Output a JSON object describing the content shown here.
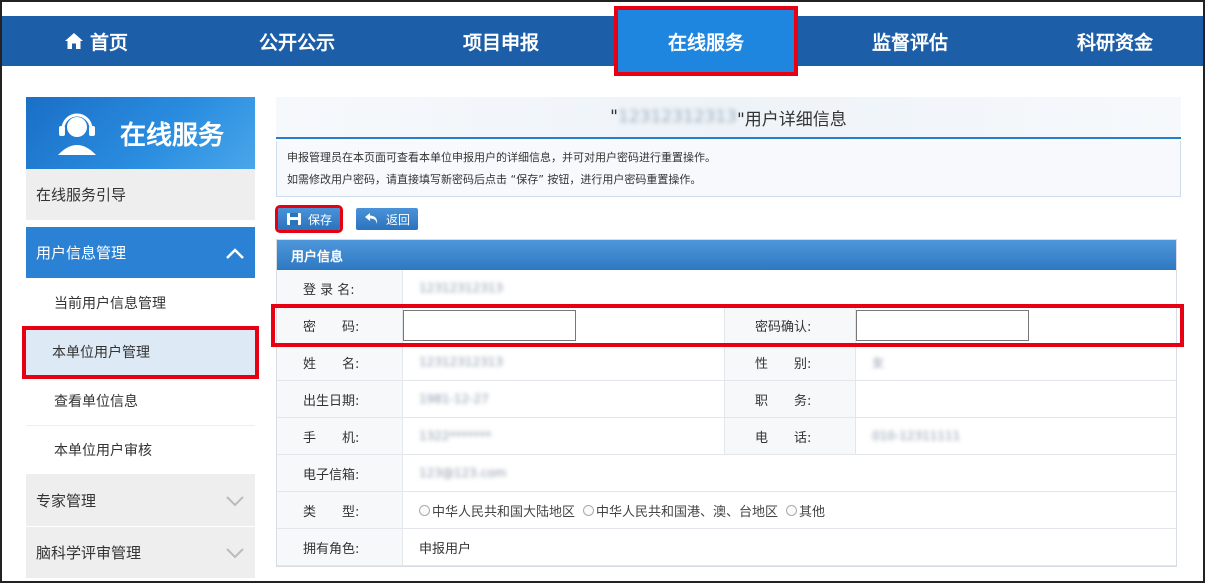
{
  "nav": {
    "items": [
      {
        "label": "首页",
        "icon": "home-icon"
      },
      {
        "label": "公开公示"
      },
      {
        "label": "项目申报"
      },
      {
        "label": "在线服务",
        "active": true
      },
      {
        "label": "监督评估"
      },
      {
        "label": "科研资金"
      }
    ]
  },
  "sidebar": {
    "title": "在线服务",
    "items": [
      {
        "label": "在线服务引导"
      },
      {
        "label": "用户信息管理",
        "expanded": true
      },
      {
        "label": "当前用户信息管理"
      },
      {
        "label": "本单位用户管理",
        "selected": true
      },
      {
        "label": "查看单位信息"
      },
      {
        "label": "本单位用户审核"
      },
      {
        "label": "专家管理"
      },
      {
        "label": "脑科学评审管理"
      }
    ]
  },
  "main": {
    "title_prefix": "\"",
    "title_blurred": "12312312313",
    "title_suffix": "\"用户详细信息",
    "info_line1": "申报管理员在本页面可查看本单位申报用户的详细信息，并可对用户密码进行重置操作。",
    "info_line2": "如需修改用户密码，请直接填写新密码后点击 “保存” 按钮，进行用户密码重置操作。",
    "save_label": "保存",
    "back_label": "返回",
    "section_title": "用户信息",
    "fields": {
      "login_label": "登 录 名:",
      "login_value": "12312312313",
      "password_label": "密　　码:",
      "password_value": "",
      "password_confirm_label": "密码确认:",
      "password_confirm_value": "",
      "name_label": "姓　　名:",
      "name_value": "12312312313",
      "gender_label": "性　　别:",
      "gender_value": "女",
      "birth_label": "出生日期:",
      "birth_value": "1981-12-27",
      "position_label": "职　　务:",
      "position_value": "",
      "mobile_label": "手　　机:",
      "mobile_value": "1322*******",
      "phone_label": "电　　话:",
      "phone_value": "010-12311111",
      "email_label": "电子信箱:",
      "email_value": "123@123.com",
      "type_label": "类　　型:",
      "type_options": [
        "中华人民共和国大陆地区",
        "中华人民共和国港、澳、台地区",
        "其他"
      ],
      "role_label": "拥有角色:",
      "role_value": "申报用户"
    }
  },
  "colors": {
    "nav_bg": "#1d5ea8",
    "nav_active": "#1f86e0",
    "highlight": "#e60012",
    "sidebar_active": "#2b82d4"
  }
}
